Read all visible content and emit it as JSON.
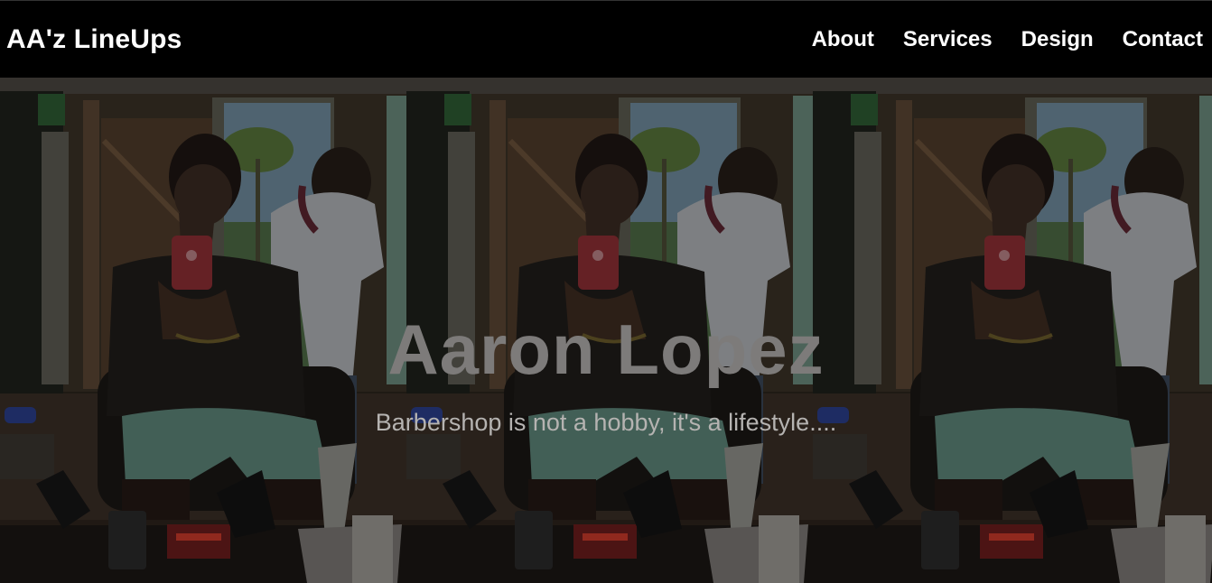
{
  "brand": {
    "name": "AA'z LineUps"
  },
  "nav": {
    "items": [
      {
        "label": "About"
      },
      {
        "label": "Services"
      },
      {
        "label": "Design"
      },
      {
        "label": "Contact"
      }
    ]
  },
  "hero": {
    "title": "Aaron Lopez",
    "subtitle": "Barbershop is not a hobby, it's a lifestyle....",
    "background_image": "barbershop-selfie-photo",
    "background_repeat": "repeat-x",
    "overlay_color": "#000000"
  },
  "colors": {
    "navbar_bg": "#000000",
    "nav_text": "#ffffff",
    "hero_title": "#7d7b7a",
    "hero_subtitle": "#b5b3b1"
  }
}
